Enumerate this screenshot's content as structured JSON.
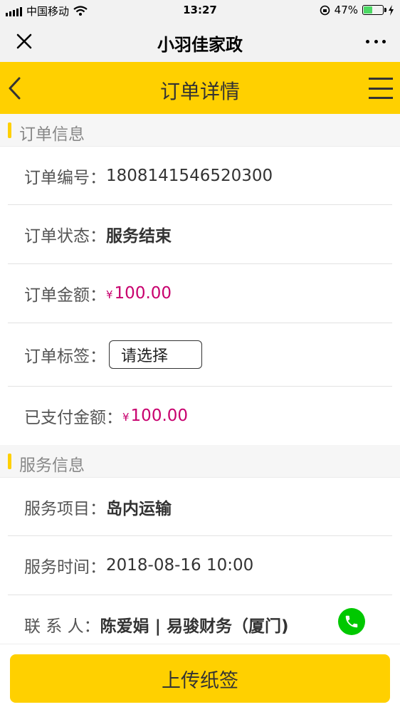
{
  "status_bar": {
    "carrier": "中国移动",
    "time": "13:27",
    "battery_percent": "47%",
    "battery_level": 0.47,
    "icons": [
      "signal-icon",
      "wifi-icon",
      "rotation-lock-icon",
      "battery-icon",
      "charging-icon"
    ]
  },
  "wechat_nav": {
    "title": "小羽佳家政",
    "close_icon": "close-icon",
    "more_icon": "more-icon"
  },
  "header": {
    "title": "订单详情",
    "back_icon": "chevron-left-icon",
    "menu_icon": "menu-icon"
  },
  "order_section": {
    "title": "订单信息",
    "rows": [
      {
        "key": "订单编号：",
        "value": "1808141546520300"
      },
      {
        "key": "订单状态：",
        "value": "服务结束"
      },
      {
        "key": "订单金额：",
        "currency": "¥",
        "value": "100.00"
      },
      {
        "key": "订单标签：",
        "select_value": "请选择"
      },
      {
        "key": "已支付金额：",
        "currency": "¥",
        "value": "100.00"
      }
    ]
  },
  "service_section": {
    "title": "服务信息",
    "rows": [
      {
        "key": "服务项目：",
        "value": "岛内运输"
      },
      {
        "key": "服务时间：",
        "value": "2018-08-16 10:00"
      },
      {
        "key": "联 系 人：",
        "value": "陈爱娟 | 易骏财务（厦门)"
      }
    ]
  },
  "colors": {
    "brand_yellow": "#ffd000",
    "money": "#c8006e",
    "phone_green": "#00c800"
  },
  "actions": {
    "upload_label": "上传纸签"
  }
}
